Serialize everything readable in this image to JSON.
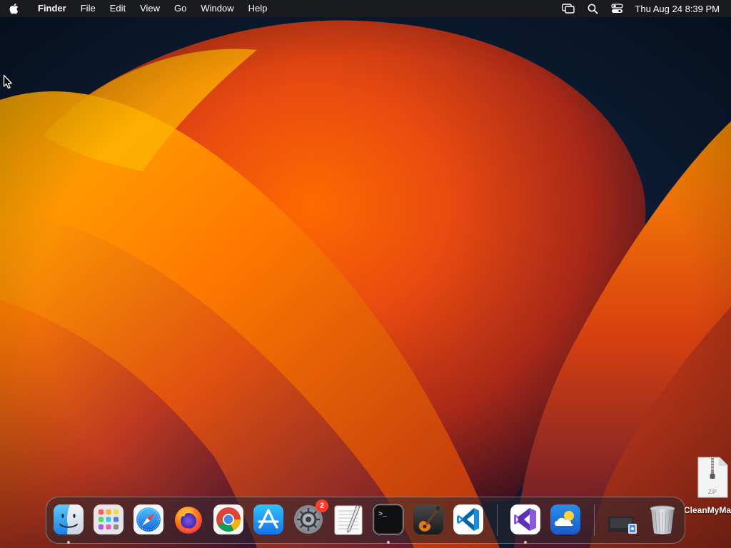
{
  "menubar": {
    "app_name": "Finder",
    "menus": [
      "File",
      "Edit",
      "View",
      "Go",
      "Window",
      "Help"
    ],
    "clock": "Thu Aug 24  8:39 PM"
  },
  "desktop": {
    "file_label": "CleanMyMac X.zip",
    "file_type_label": "ZIP"
  },
  "dock": {
    "apps": [
      {
        "name": "Finder",
        "running": true
      },
      {
        "name": "Launchpad",
        "running": false
      },
      {
        "name": "Safari",
        "running": false
      },
      {
        "name": "Firefox",
        "running": false
      },
      {
        "name": "Google Chrome",
        "running": false
      },
      {
        "name": "App Store",
        "running": false
      },
      {
        "name": "System Settings",
        "running": false,
        "badge": "2"
      },
      {
        "name": "TextEdit",
        "running": false
      },
      {
        "name": "Terminal",
        "running": true
      },
      {
        "name": "GarageBand",
        "running": false
      },
      {
        "name": "Visual Studio Code",
        "running": false
      },
      {
        "name": "Visual Studio",
        "running": true
      },
      {
        "name": "Weather",
        "running": false
      },
      {
        "name": "Downloads",
        "running": false
      },
      {
        "name": "Trash",
        "running": false
      }
    ],
    "terminal_prompt": ">_"
  },
  "colors": {
    "menubar_bg": "#1c1c1e",
    "badge": "#ff3b30",
    "wallpaper_orange": "#ff8a00",
    "wallpaper_deep": "#0b1a30"
  }
}
